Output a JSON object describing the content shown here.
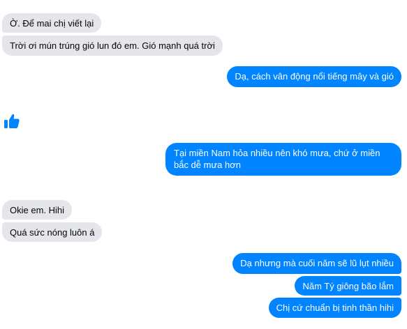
{
  "messages": [
    {
      "id": "m1",
      "sender": "other",
      "text": "Ờ. Để mai chị viết lại"
    },
    {
      "id": "m2",
      "sender": "other",
      "text": "Trời ơi mún trúng gió lun đó em. Gió mạnh quá trời"
    },
    {
      "id": "m3",
      "sender": "me",
      "text": "Dạ, cách vân động nổi tiếng mây và gió"
    },
    {
      "id": "m4",
      "sender": "me",
      "text": "Tại miền Nam hỏa nhiều nên khó mưa, chứ ở miền bắc dễ mưa hơn"
    },
    {
      "id": "m5",
      "sender": "other",
      "text": "Okie em. Hihi"
    },
    {
      "id": "m6",
      "sender": "other",
      "text": "Quá sức nóng luôn á"
    },
    {
      "id": "m7",
      "sender": "me",
      "text": "Dạ nhưng mà cuối năm sẽ lũ lụt nhiều"
    },
    {
      "id": "m8",
      "sender": "me",
      "text": "Năm Tý giông bão lắm"
    },
    {
      "id": "m9",
      "sender": "me",
      "text": "Chị cứ chuẩn bị tinh thần hihi"
    }
  ],
  "like_reaction": {
    "icon": "thumbs-up-icon",
    "color": "#0084ff"
  },
  "colors": {
    "incoming_bubble": "#e4e6eb",
    "outgoing_bubble": "#0084ff",
    "outgoing_text": "#ffffff"
  }
}
